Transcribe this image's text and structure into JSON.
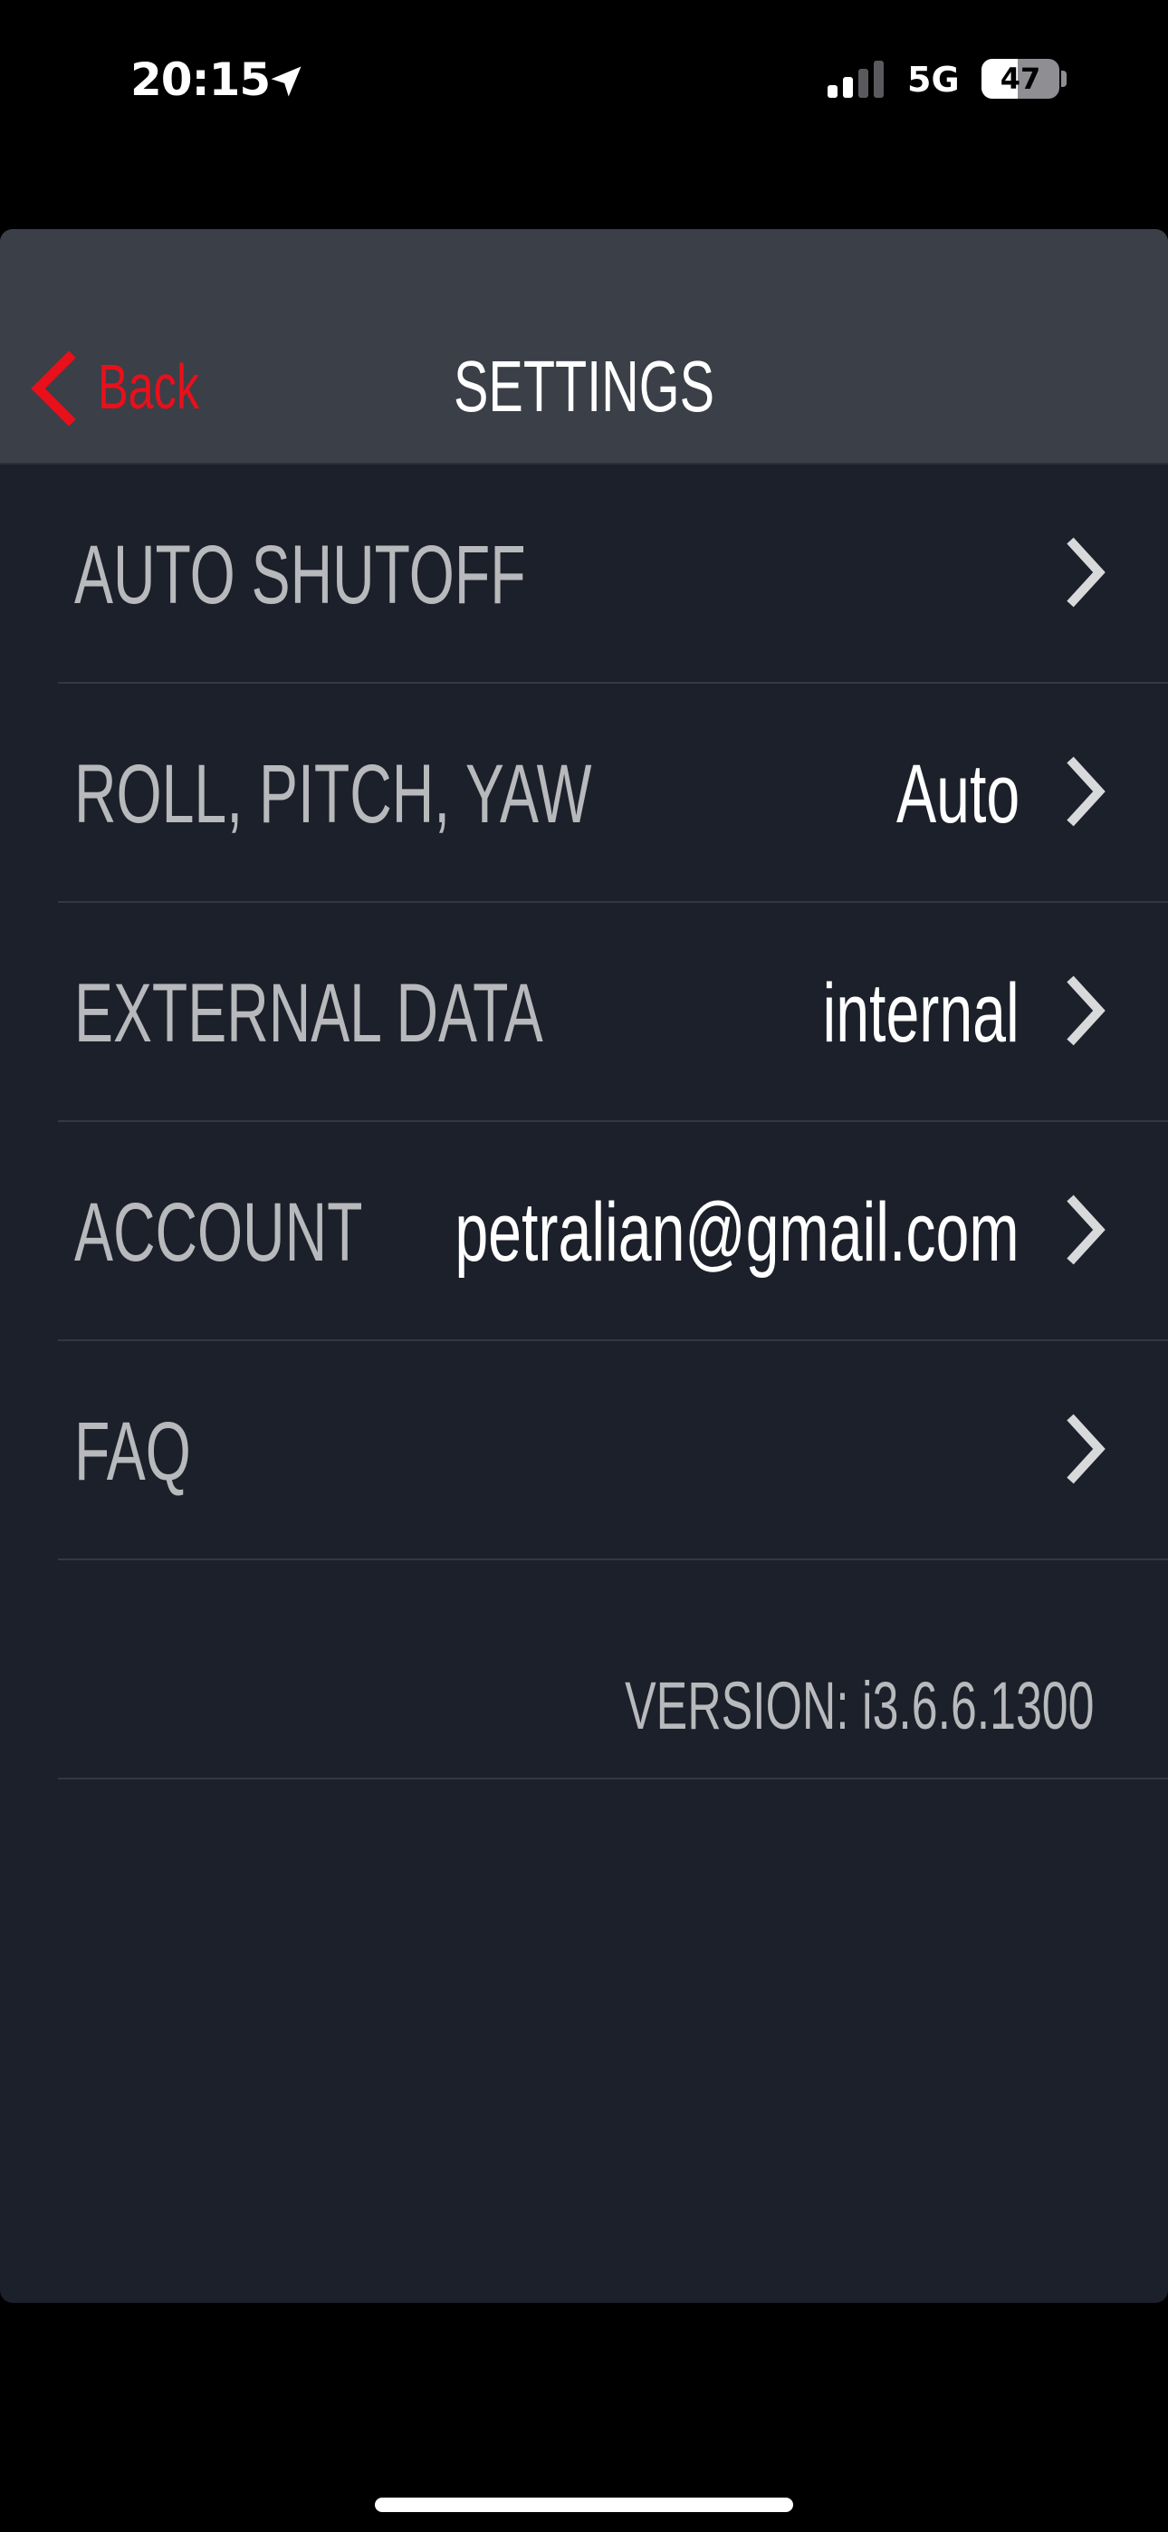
{
  "status_bar": {
    "time": "20:15",
    "time_icon": "location-arrow-icon",
    "signal_icon": "cellular-signal-icon",
    "network": "5G",
    "battery_level": "47",
    "battery_fraction": 0.47
  },
  "nav": {
    "back_label": "Back",
    "back_icon": "chevron-left-icon",
    "title": "SETTINGS",
    "back_color": "#e8101a"
  },
  "settings": {
    "items": [
      {
        "label": "AUTO SHUTOFF",
        "value": "",
        "icon": "chevron-right-icon"
      },
      {
        "label": "ROLL, PITCH,  YAW",
        "value": "Auto",
        "icon": "chevron-right-icon"
      },
      {
        "label": "EXTERNAL DATA",
        "value": "internal",
        "icon": "chevron-right-icon"
      },
      {
        "label": "ACCOUNT",
        "value": "petralian@gmail.com",
        "icon": "chevron-right-icon"
      },
      {
        "label": "FAQ",
        "value": "",
        "icon": "chevron-right-icon"
      }
    ],
    "version": "VERSION: i3.6.6.1300"
  },
  "colors": {
    "panel_background": "#1c202a",
    "nav_background": "#3a3f48",
    "label_text": "#b8b9bc",
    "value_text": "#ffffff",
    "accent": "#e8101a"
  }
}
